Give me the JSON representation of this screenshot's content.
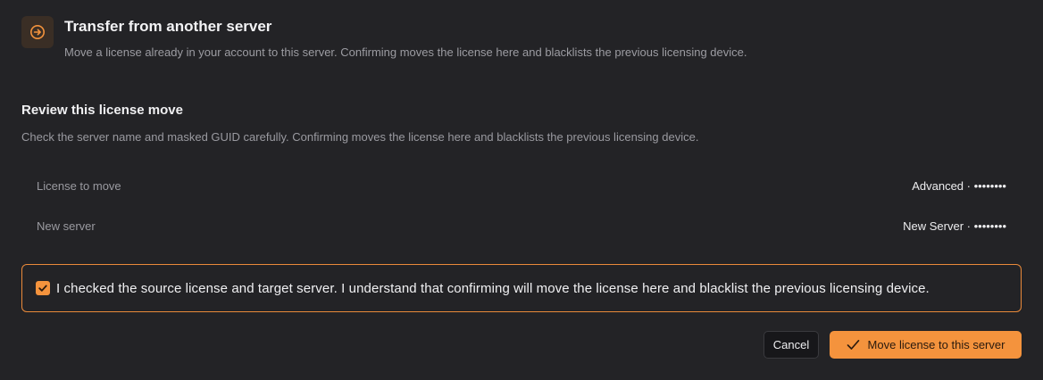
{
  "header": {
    "icon": "arrow-right-circle-icon",
    "title": "Transfer from another server",
    "description": "Move a license already in your account to this server. Confirming moves the license here and blacklists the previous licensing device."
  },
  "review": {
    "title": "Review this license move",
    "description": "Check the server name and masked GUID carefully. Confirming moves the license here and blacklists the previous licensing device.",
    "rows": [
      {
        "label": "License to move",
        "value": "Advanced · ••••••••"
      },
      {
        "label": "New server",
        "value": "New Server · ••••••••"
      }
    ]
  },
  "confirmation": {
    "checked": true,
    "text": "I checked the source license and target server. I understand that confirming will move the license here and blacklist the previous licensing device."
  },
  "actions": {
    "cancel_label": "Cancel",
    "move_label": "Move license to this server",
    "move_icon": "checkmark-icon"
  },
  "colors": {
    "accent": "#f4933d",
    "background": "#232326"
  }
}
